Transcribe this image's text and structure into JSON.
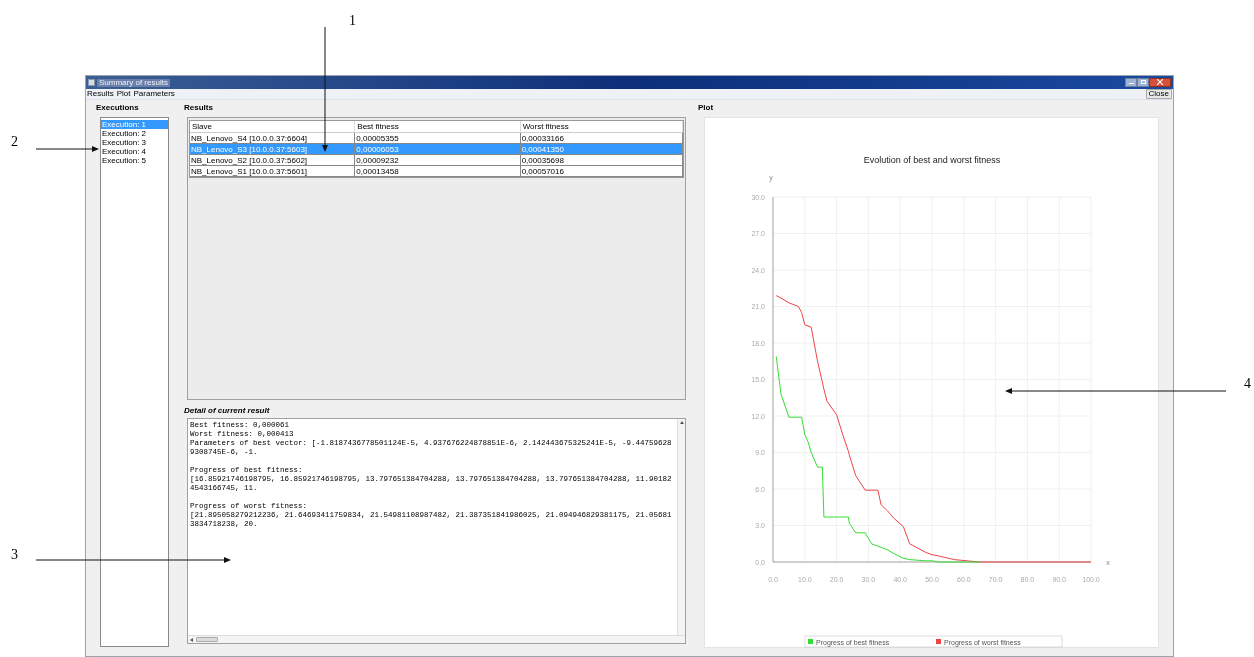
{
  "callouts": [
    "1",
    "2",
    "3",
    "4"
  ],
  "window": {
    "title": "Summary of results"
  },
  "menu": [
    "Results",
    "Plot",
    "Parameters"
  ],
  "close_button": "Close",
  "executions": {
    "title": "Executions",
    "items": [
      {
        "label": "Execution: 1",
        "selected": true
      },
      {
        "label": "Execution: 2",
        "selected": false
      },
      {
        "label": "Execution: 3",
        "selected": false
      },
      {
        "label": "Execution: 4",
        "selected": false
      },
      {
        "label": "Execution: 5",
        "selected": false
      }
    ]
  },
  "results": {
    "title": "Results",
    "columns": [
      "Slave",
      "Best fitness",
      "Worst fitness"
    ],
    "rows": [
      {
        "cells": [
          "NB_Lenovo_S4 [10.0.0.37:6604]",
          "0,00005355",
          "0,00033166"
        ],
        "selected": false
      },
      {
        "cells": [
          "NB_Lenovo_S3 [10.0.0.37:5603]",
          "0,00006053",
          "0,00041350"
        ],
        "selected": true
      },
      {
        "cells": [
          "NB_Lenovo_S2 [10.0.0.37:5602]",
          "0,00009232",
          "0,00035698"
        ],
        "selected": false
      },
      {
        "cells": [
          "NB_Lenovo_S1 [10.0.0.37:5601]",
          "0,00013458",
          "0,00057016"
        ],
        "selected": false
      }
    ]
  },
  "detail": {
    "title": "Detail of current result",
    "paragraphs": [
      [
        "Best fitness: 0,000061",
        "Worst fitness: 0,000413",
        "Parameters of best vector: [-1.8187436778501124E-5, 4.937676224878851E-6, 2.142443675325241E-5, -9.447596289308745E-6, -1."
      ],
      [
        "Progress of best fitness:",
        "[16.85921746198795, 16.85921746198795, 13.797651384704288, 13.797651384704288, 13.797651384704288, 11.901824543166745, 11."
      ],
      [
        "Progress of worst fitness:",
        "[21.895058279212236, 21.64693411759834, 21.54981108987482, 21.387351841986025, 21.094946829381175, 21.056813834718238, 20."
      ]
    ]
  },
  "plot": {
    "title": "Plot",
    "chart_data": {
      "type": "line",
      "title": "Evolution of best and worst fitness",
      "xlabel": "x",
      "ylabel": "y",
      "x": [
        1,
        2.5,
        5,
        8,
        9,
        10,
        11,
        12,
        14,
        15.5,
        16,
        17,
        20,
        22,
        23.7,
        24,
        26,
        29,
        31,
        33,
        34,
        36,
        38,
        41,
        43,
        48,
        50,
        52,
        57,
        65,
        70,
        100
      ],
      "series": [
        {
          "name": "Progress of best fitness",
          "color": "#33dd33",
          "values": [
            16.9,
            13.8,
            11.9,
            11.9,
            11.9,
            10.5,
            9.9,
            9.0,
            7.8,
            7.8,
            3.7,
            3.7,
            3.7,
            3.7,
            3.7,
            3.2,
            2.4,
            2.4,
            1.5,
            1.3,
            1.2,
            1.0,
            0.7,
            0.3,
            0.2,
            0.1,
            0.1,
            0.0,
            0.0,
            0.0,
            null,
            null
          ]
        },
        {
          "name": "Progress of worst fitness",
          "color": "#ee4444",
          "values": [
            21.9,
            21.7,
            21.3,
            21.0,
            20.5,
            19.5,
            19.4,
            19.3,
            16.5,
            14.8,
            14.2,
            13.2,
            12.1,
            10.4,
            9.1,
            8.8,
            7.1,
            5.9,
            5.9,
            5.9,
            4.7,
            4.2,
            3.6,
            2.9,
            1.5,
            0.8,
            0.6,
            0.5,
            0.2,
            0.0,
            0,
            0
          ]
        }
      ],
      "grid": true,
      "legend": "bottom",
      "xlim": [
        0,
        100
      ],
      "ylim": [
        0,
        30
      ],
      "xticks": [
        {
          "value": 0,
          "label": "0.0"
        },
        {
          "value": 10,
          "label": "10.0"
        },
        {
          "value": 20,
          "label": "20.0"
        },
        {
          "value": 30,
          "label": "30.0"
        },
        {
          "value": 40,
          "label": "40.0"
        },
        {
          "value": 50,
          "label": "50.0"
        },
        {
          "value": 60,
          "label": "60.0"
        },
        {
          "value": 70,
          "label": "70.0"
        },
        {
          "value": 80,
          "label": "80.0"
        },
        {
          "value": 90,
          "label": "90.0"
        },
        {
          "value": 100,
          "label": "100.0"
        }
      ],
      "yticks": [
        {
          "value": 0,
          "label": "0.0"
        },
        {
          "value": 3,
          "label": "3.0"
        },
        {
          "value": 6,
          "label": "6.0"
        },
        {
          "value": 9,
          "label": "9.0"
        },
        {
          "value": 12,
          "label": "12.0"
        },
        {
          "value": 15,
          "label": "15.0"
        },
        {
          "value": 18,
          "label": "18.0"
        },
        {
          "value": 21,
          "label": "21.0"
        },
        {
          "value": 24,
          "label": "24.0"
        },
        {
          "value": 27,
          "label": "27.0"
        },
        {
          "value": 30,
          "label": "30.0"
        }
      ]
    }
  }
}
